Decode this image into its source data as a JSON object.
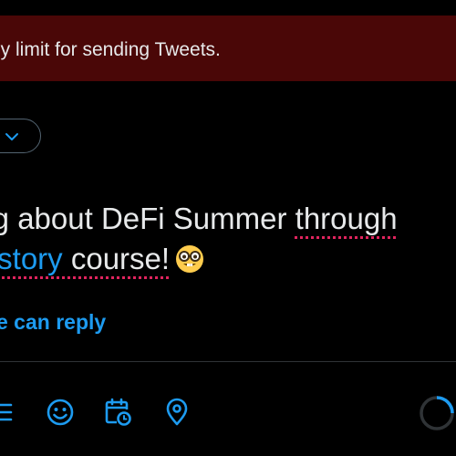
{
  "banner": {
    "message": "ly limit for sending Tweets."
  },
  "composer": {
    "audience_icon": "chevron-down-icon",
    "tweet_line1_a": "ing about DeFi Summer ",
    "tweet_line1_b": "through",
    "tweet_line2_link": "History",
    "tweet_line2_text": " course!",
    "tweet_emoji": "nerd-face-emoji",
    "reply_setting": "e can reply"
  },
  "toolbar": {
    "icons": [
      "list-icon",
      "emoji-icon",
      "schedule-icon",
      "location-icon",
      "character-progress-ring"
    ]
  },
  "colors": {
    "background": "#000000",
    "banner": "#4a0707",
    "accent": "#1d9bf0",
    "text": "#e7e9ea",
    "border": "#536471",
    "spellcheck": "#e0245e"
  }
}
